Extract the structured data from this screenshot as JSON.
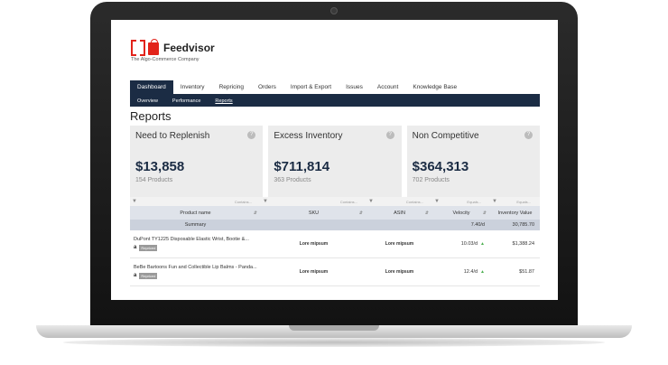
{
  "brand": {
    "name": "Feedvisor",
    "tagline": "The Algo-Commerce Company",
    "color": "#e2231a"
  },
  "nav": {
    "items": [
      "Dashboard",
      "Inventory",
      "Repricing",
      "Orders",
      "Import & Export",
      "Issues",
      "Account",
      "Knowledge Base"
    ],
    "sub_items": [
      "Overview",
      "Performance",
      "Reports"
    ]
  },
  "page": {
    "title": "Reports"
  },
  "cards": [
    {
      "title": "Need to Replenish",
      "value": "$13,858",
      "sub": "154 Products"
    },
    {
      "title": "Excess Inventory",
      "value": "$711,814",
      "sub": "363 Products"
    },
    {
      "title": "Non Competitive",
      "value": "$364,313",
      "sub": "702 Products"
    }
  ],
  "table": {
    "filters": [
      "Contains...",
      "Contains...",
      "Contains...",
      "Equals...",
      "Equals..."
    ],
    "headers": [
      "Product name",
      "SKU",
      "ASIN",
      "Velocity",
      "Inventory Value"
    ],
    "summary": {
      "label": "Summary",
      "velocity": "7.40/d",
      "inventory_value": "30,785.70"
    },
    "rows": [
      {
        "name": "DuPont TY1225 Disposable Elastic Wrist, Bootie &...",
        "amazon": "a",
        "badge": "Repriced",
        "sku": "Lore mipsum",
        "asin": "Lore mipsum",
        "velocity": "10.03/d",
        "inventory_value": "$1,388.24"
      },
      {
        "name": "BeBe Bartoons Fun and Collectible Lip Balms - Panda...",
        "amazon": "a",
        "badge": "Repriced",
        "sku": "Lore mipsum",
        "asin": "Lore mipsum",
        "velocity": "12.4/d",
        "inventory_value": "$51.87"
      }
    ]
  },
  "icons": {
    "help": "?",
    "filter": "funnel-icon",
    "sort": "sort-icon",
    "trend": "trend-up-icon"
  },
  "colors": {
    "navy": "#1b2c44",
    "accent": "#e2231a",
    "trend_up": "#4caf50"
  }
}
